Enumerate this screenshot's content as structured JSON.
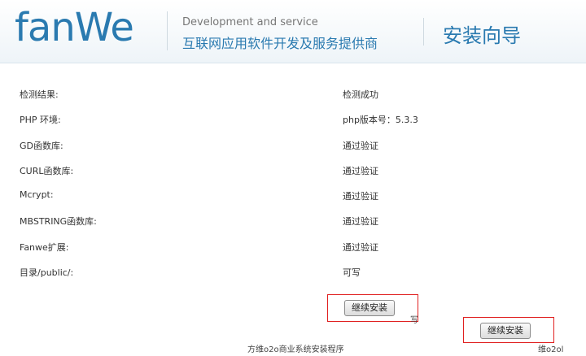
{
  "header": {
    "logo_text": "fanWe",
    "tagline_en": "Development and service",
    "tagline_cn": "互联网应用软件开发及服务提供商",
    "wizard_title": "安装向导"
  },
  "checks": [
    {
      "label": "检测结果:",
      "value": "检测成功"
    },
    {
      "label": "PHP 环境:",
      "value": "php版本号：5.3.3"
    },
    {
      "label": "GD函数库:",
      "value": "通过验证"
    },
    {
      "label": "CURL函数库:",
      "value": "通过验证"
    },
    {
      "label": "Mcrypt:",
      "value": "通过验证"
    },
    {
      "label": "MBSTRING函数库:",
      "value": "通过验证"
    },
    {
      "label": "Fanwe扩展:",
      "value": "通过验证"
    },
    {
      "label": "目录/public/:",
      "value": "可写"
    }
  ],
  "buttons": {
    "continue_1": "继续安装",
    "continue_2": "继续安装"
  },
  "footer": {
    "text": "方维o2o商业系统安装程序",
    "text_right": "维o2ol"
  },
  "stray": {
    "a": "写"
  },
  "colors": {
    "brand": "#2a7ab0",
    "highlight": "#e02020"
  }
}
